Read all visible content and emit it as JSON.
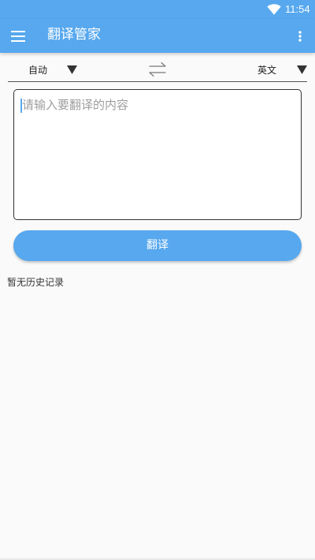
{
  "status_bar": {
    "time": "11:54",
    "wifi_icon": "wifi-icon",
    "color": "#57a8ee"
  },
  "app_bar": {
    "title": "翻译管家",
    "menu_icon": "hamburger-menu-icon",
    "overflow_icon": "more-vert-icon"
  },
  "language": {
    "source": "自动",
    "target": "英文",
    "swap_icon": "swap-arrows-icon",
    "dropdown_icon": "dropdown-triangle-icon"
  },
  "input": {
    "value": "",
    "placeholder": "请输入要翻译的内容"
  },
  "actions": {
    "translate_label": "翻译"
  },
  "history": {
    "empty_text": "暂无历史记录"
  },
  "theme": {
    "accent": "#57a8ee",
    "background": "#fafafa"
  }
}
